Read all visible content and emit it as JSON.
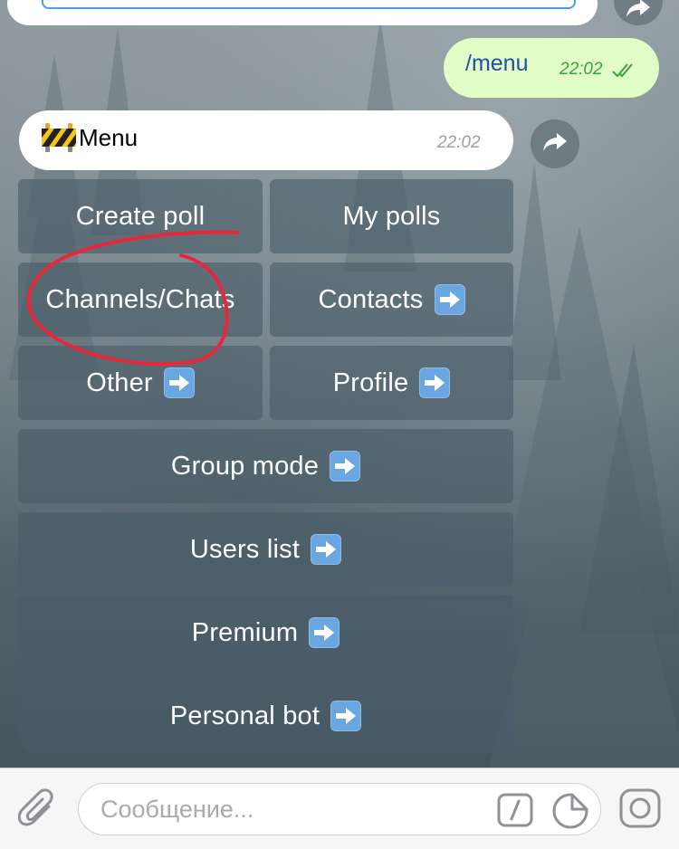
{
  "chat": {
    "outgoing": {
      "text": "/menu",
      "time": "22:02"
    },
    "incoming": {
      "emoji": "construction-sign-icon",
      "text": "Menu",
      "time": "22:02"
    }
  },
  "keyboard": {
    "rows": [
      [
        "Create poll",
        "My polls"
      ],
      [
        "Channels/Chats",
        "Contacts"
      ],
      [
        "Other",
        "Profile"
      ],
      [
        "Group mode"
      ],
      [
        "Users list"
      ],
      [
        "Premium"
      ],
      [
        "Personal bot"
      ]
    ]
  },
  "composer": {
    "placeholder": "Сообщение...",
    "icons": [
      "paperclip-icon",
      "slash-command-icon",
      "sticker-icon",
      "camera-icon"
    ]
  },
  "colors": {
    "outgoing_bubble": "#e1fec6",
    "incoming_bubble": "#ffffff",
    "keyboard_button": "#495c68",
    "annotation": "#e8283a",
    "arrow_badge": "#6aa7e0"
  }
}
